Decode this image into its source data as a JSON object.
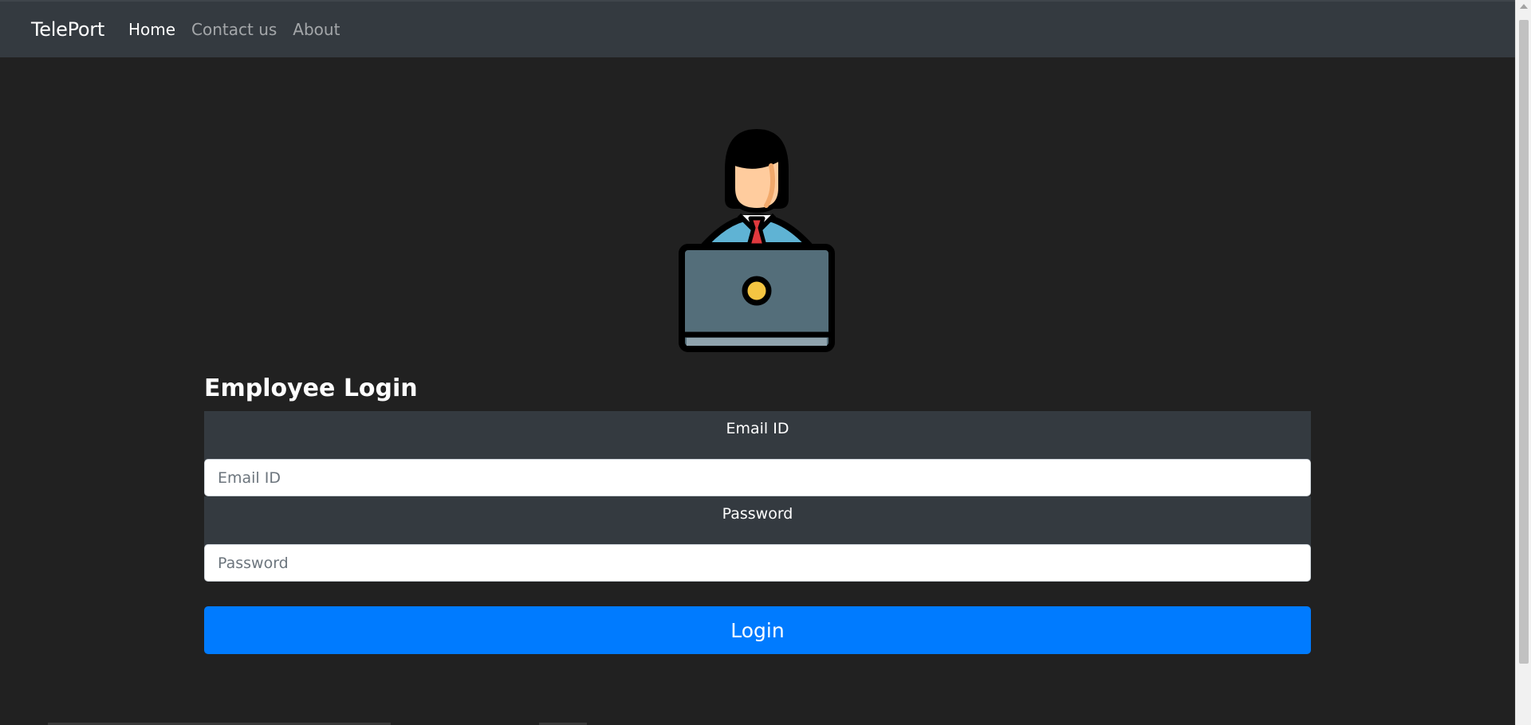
{
  "navbar": {
    "brand": "TelePort",
    "links": [
      {
        "label": "Home",
        "active": true
      },
      {
        "label": "Contact us",
        "active": false
      },
      {
        "label": "About",
        "active": false
      }
    ]
  },
  "avatar": {
    "icon": "employee-laptop-icon"
  },
  "login": {
    "title": "Employee Login",
    "email_label": "Email ID",
    "email_placeholder": "Email ID",
    "email_value": "",
    "password_label": "Password",
    "password_placeholder": "Password",
    "password_value": "",
    "button_label": "Login"
  },
  "colors": {
    "background": "#212121",
    "navbar": "#343a40",
    "primary": "#007bff"
  }
}
